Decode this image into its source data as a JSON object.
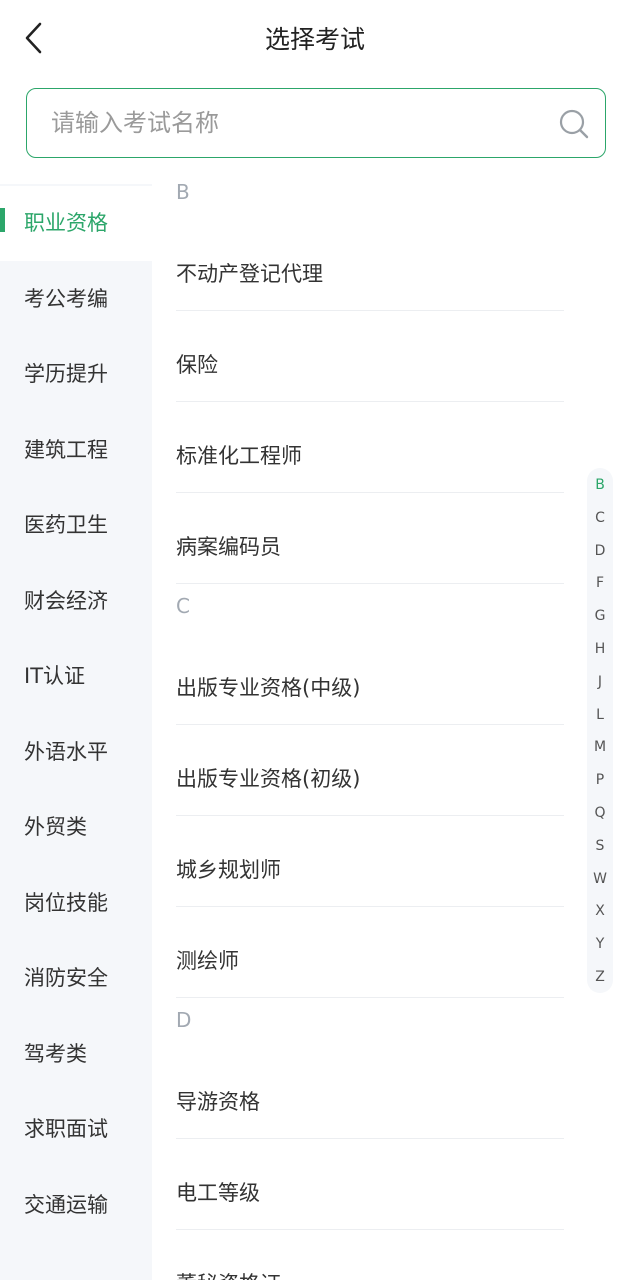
{
  "header": {
    "title": "选择考试"
  },
  "search": {
    "placeholder": "请输入考试名称"
  },
  "sidebar": {
    "items": [
      {
        "label": "职业资格",
        "active": true
      },
      {
        "label": "考公考编",
        "active": false
      },
      {
        "label": "学历提升",
        "active": false
      },
      {
        "label": "建筑工程",
        "active": false
      },
      {
        "label": "医药卫生",
        "active": false
      },
      {
        "label": "财会经济",
        "active": false
      },
      {
        "label": "IT认证",
        "active": false
      },
      {
        "label": "外语水平",
        "active": false
      },
      {
        "label": "外贸类",
        "active": false
      },
      {
        "label": "岗位技能",
        "active": false
      },
      {
        "label": "消防安全",
        "active": false
      },
      {
        "label": "驾考类",
        "active": false
      },
      {
        "label": "求职面试",
        "active": false
      },
      {
        "label": "交通运输",
        "active": false
      }
    ]
  },
  "sections": [
    {
      "letter": "B",
      "items": [
        "不动产登记代理",
        "保险",
        "标准化工程师",
        "病案编码员"
      ]
    },
    {
      "letter": "C",
      "items": [
        "出版专业资格(中级)",
        "出版专业资格(初级)",
        "城乡规划师",
        "测绘师"
      ]
    },
    {
      "letter": "D",
      "items": [
        "导游资格",
        "电工等级",
        "董秘资格证"
      ]
    }
  ],
  "index_letters": [
    "B",
    "C",
    "D",
    "F",
    "G",
    "H",
    "J",
    "L",
    "M",
    "P",
    "Q",
    "S",
    "W",
    "X",
    "Y",
    "Z"
  ],
  "index_active": "B",
  "colors": {
    "accent": "#2ca66a",
    "sidebar_bg": "#f5f7fa",
    "divider": "#eceef1",
    "section_header": "#a2a9b2"
  },
  "icons": {
    "back": "chevron-left-icon",
    "search": "search-icon"
  }
}
